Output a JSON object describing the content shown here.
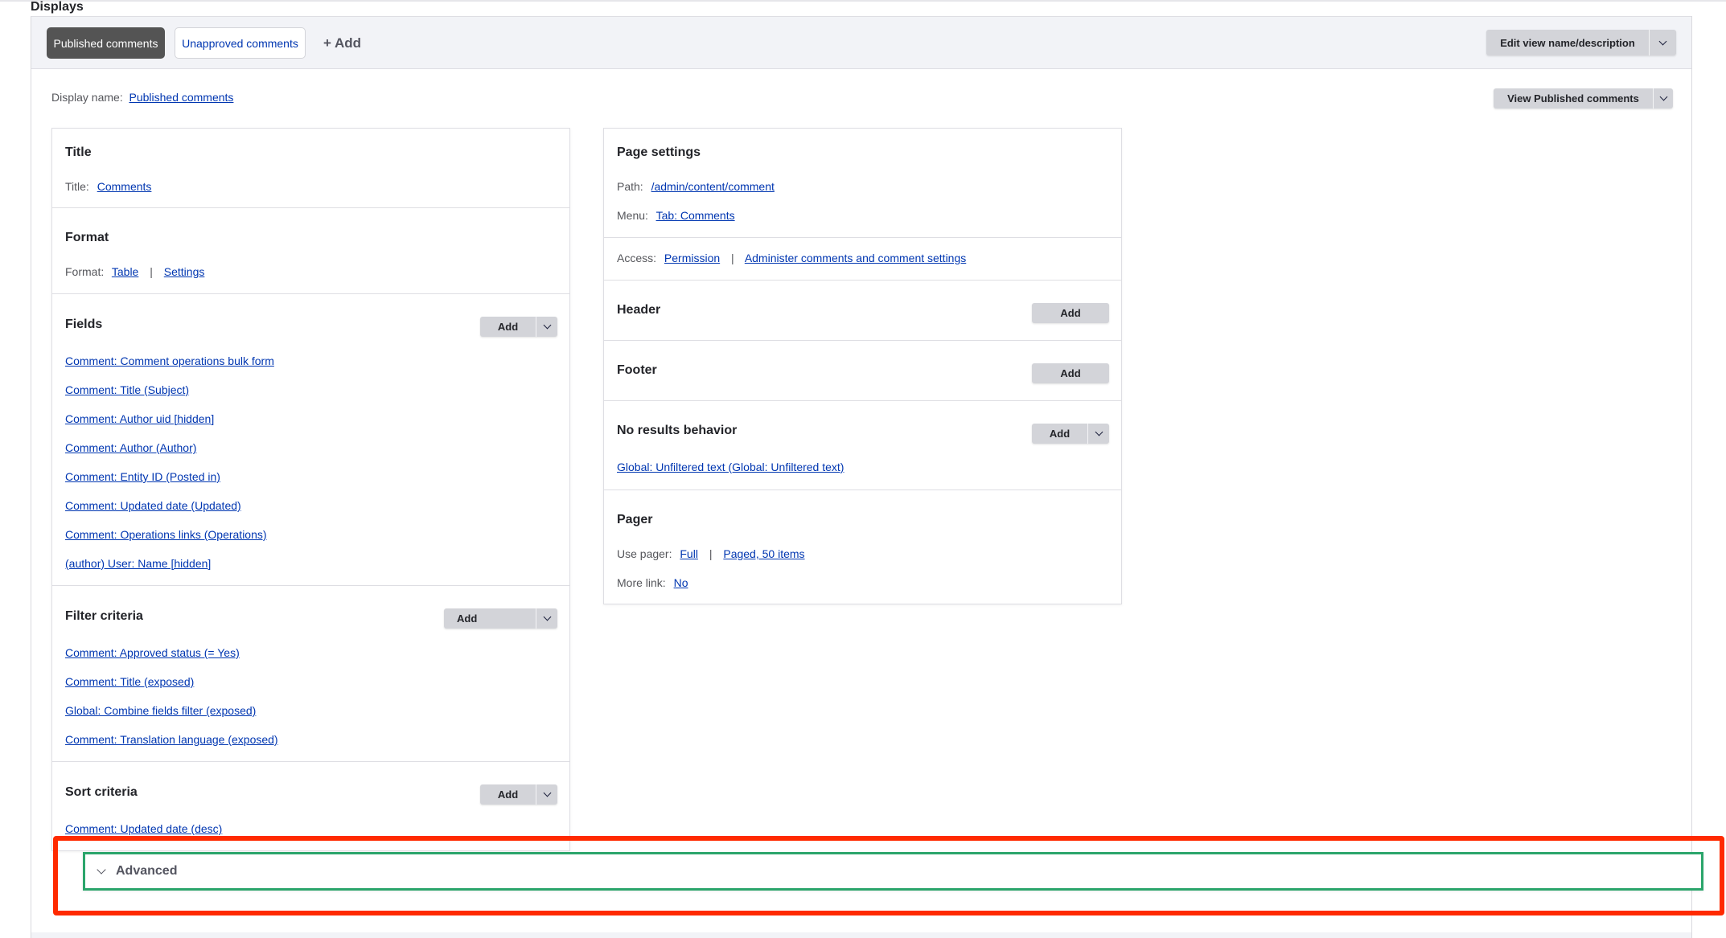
{
  "page": {
    "section_title": "Displays"
  },
  "tabs": {
    "items": [
      {
        "label": "Published comments",
        "active": true
      },
      {
        "label": "Unapproved comments",
        "active": false
      }
    ],
    "add_label": "+ Add"
  },
  "toolbar": {
    "edit_view_label": "Edit view name/description",
    "view_display_label": "View Published comments"
  },
  "display_name": {
    "label": "Display name:",
    "value": "Published comments"
  },
  "left": {
    "title": {
      "heading": "Title",
      "label": "Title:",
      "value": "Comments"
    },
    "format": {
      "heading": "Format",
      "label": "Format:",
      "value": "Table",
      "settings": "Settings",
      "separator": "|"
    },
    "fields": {
      "heading": "Fields",
      "add_label": "Add",
      "items": [
        "Comment: Comment operations bulk form",
        "Comment: Title (Subject)",
        "Comment: Author uid [hidden]",
        "Comment: Author (Author)",
        "Comment: Entity ID (Posted in)",
        "Comment: Updated date (Updated)",
        "Comment: Operations links (Operations)",
        "(author) User: Name [hidden]"
      ]
    },
    "filters": {
      "heading": "Filter criteria",
      "add_label": "Add",
      "items": [
        "Comment: Approved status (= Yes)",
        "Comment: Title (exposed)",
        "Global: Combine fields filter (exposed)",
        "Comment: Translation language (exposed)"
      ]
    },
    "sorts": {
      "heading": "Sort criteria",
      "add_label": "Add",
      "items": [
        "Comment: Updated date (desc)"
      ]
    }
  },
  "right": {
    "page_settings": {
      "heading": "Page settings",
      "path_label": "Path:",
      "path_value": "/admin/content/comment",
      "menu_label": "Menu:",
      "menu_value": "Tab: Comments"
    },
    "access": {
      "label": "Access:",
      "type": "Permission",
      "separator": "|",
      "value": "Administer comments and comment settings"
    },
    "header": {
      "heading": "Header",
      "add_label": "Add"
    },
    "footer": {
      "heading": "Footer",
      "add_label": "Add"
    },
    "no_results": {
      "heading": "No results behavior",
      "add_label": "Add",
      "items": [
        "Global: Unfiltered text (Global: Unfiltered text)"
      ]
    },
    "pager": {
      "heading": "Pager",
      "use_pager_label": "Use pager:",
      "use_pager_value": "Full",
      "separator": "|",
      "paged_value": "Paged, 50 items",
      "more_link_label": "More link:",
      "more_link_value": "No"
    }
  },
  "advanced": {
    "label": "Advanced",
    "expanded": false
  },
  "annotations": {
    "highlight_outer_color": "#ff2a00",
    "highlight_inner_color": "#2ba56b"
  }
}
